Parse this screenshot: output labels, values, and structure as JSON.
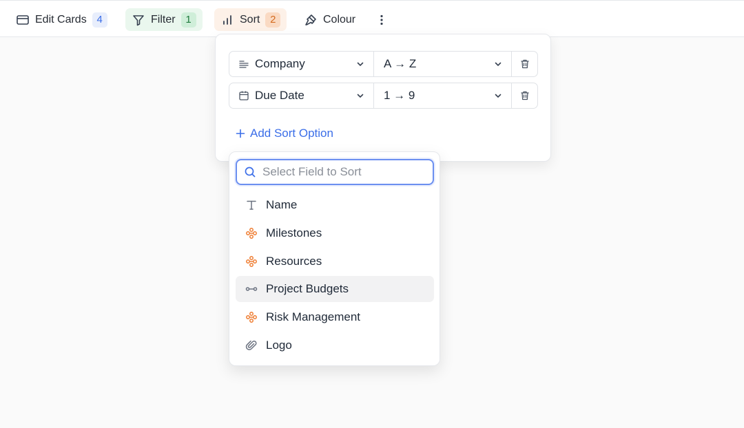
{
  "toolbar": {
    "edit_cards": {
      "label": "Edit Cards",
      "count": "4"
    },
    "filter": {
      "label": "Filter",
      "count": "1"
    },
    "sort": {
      "label": "Sort",
      "count": "2"
    },
    "colour": {
      "label": "Colour"
    }
  },
  "sort_panel": {
    "rows": [
      {
        "field": "Company",
        "direction": "A → Z"
      },
      {
        "field": "Due Date",
        "direction": "1 → 9"
      }
    ],
    "add_label": "Add Sort Option"
  },
  "field_picker": {
    "search_placeholder": "Select Field to Sort",
    "search_value": "",
    "options": [
      {
        "label": "Name",
        "icon": "text-type-icon"
      },
      {
        "label": "Milestones",
        "icon": "link-node-icon"
      },
      {
        "label": "Resources",
        "icon": "link-node-icon"
      },
      {
        "label": "Project Budgets",
        "icon": "lookup-icon"
      },
      {
        "label": "Risk Management",
        "icon": "link-node-icon"
      },
      {
        "label": "Logo",
        "icon": "paperclip-icon"
      }
    ],
    "hovered_option": "Project Budgets"
  },
  "colors": {
    "accent": "#3b6ee8",
    "link_orange": "#ef7d32",
    "filter_bg": "#eaf7ee",
    "sort_bg": "#fdf1e8"
  }
}
